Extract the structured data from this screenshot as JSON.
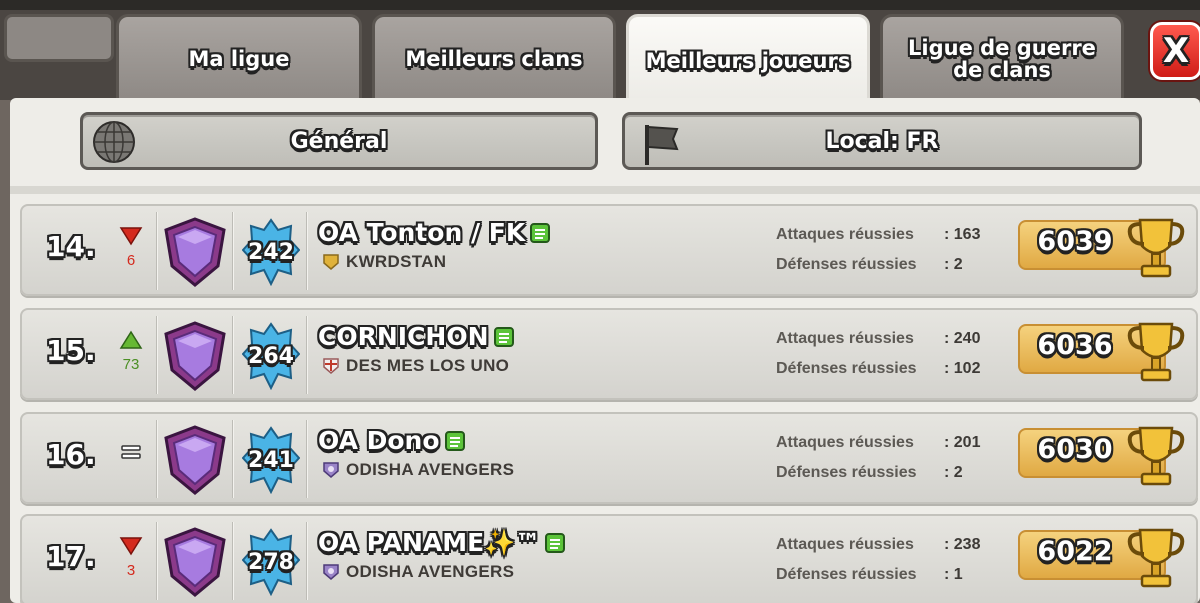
{
  "tabs": [
    {
      "label": "Ma ligue",
      "active": false
    },
    {
      "label": "Meilleurs clans",
      "active": false
    },
    {
      "label": "Meilleurs joueurs",
      "active": true
    },
    {
      "label": "Ligue de guerre de clans",
      "active": false
    }
  ],
  "close": {
    "label": "X"
  },
  "filters": {
    "general": {
      "label": "Général",
      "icon": "globe-icon"
    },
    "local": {
      "label": "Local: FR",
      "icon": "flag-icon"
    }
  },
  "stat_labels": {
    "attacks": "Attaques réussies",
    "defenses": "Défenses réussies"
  },
  "rows": [
    {
      "rank": "14.",
      "trend": "down",
      "change": "6",
      "level": "242",
      "name": "OA Tonton / FK",
      "clan": "KWRDSTAN",
      "clan_badge": "gold",
      "attacks": ": 163",
      "defenses": ": 2",
      "trophies": "6039"
    },
    {
      "rank": "15.",
      "trend": "up",
      "change": "73",
      "level": "264",
      "name": "CORNICHON",
      "clan": "DES MES LOS UNO",
      "clan_badge": "white",
      "attacks": ": 240",
      "defenses": ": 102",
      "trophies": "6036"
    },
    {
      "rank": "16.",
      "trend": "same",
      "change": "",
      "level": "241",
      "name": "OA Dono",
      "clan": "ODISHA AVENGERS",
      "clan_badge": "purple",
      "attacks": ": 201",
      "defenses": ": 2",
      "trophies": "6030"
    },
    {
      "rank": "17.",
      "trend": "down",
      "change": "3",
      "level": "278",
      "name": "OA PANAME✨™",
      "clan": "ODISHA AVENGERS",
      "clan_badge": "purple",
      "attacks": ": 238",
      "defenses": ": 1",
      "trophies": "6022"
    }
  ],
  "colors": {
    "down": "#d42a1e",
    "up": "#5aa82a",
    "trophy_box": "#efc062"
  }
}
